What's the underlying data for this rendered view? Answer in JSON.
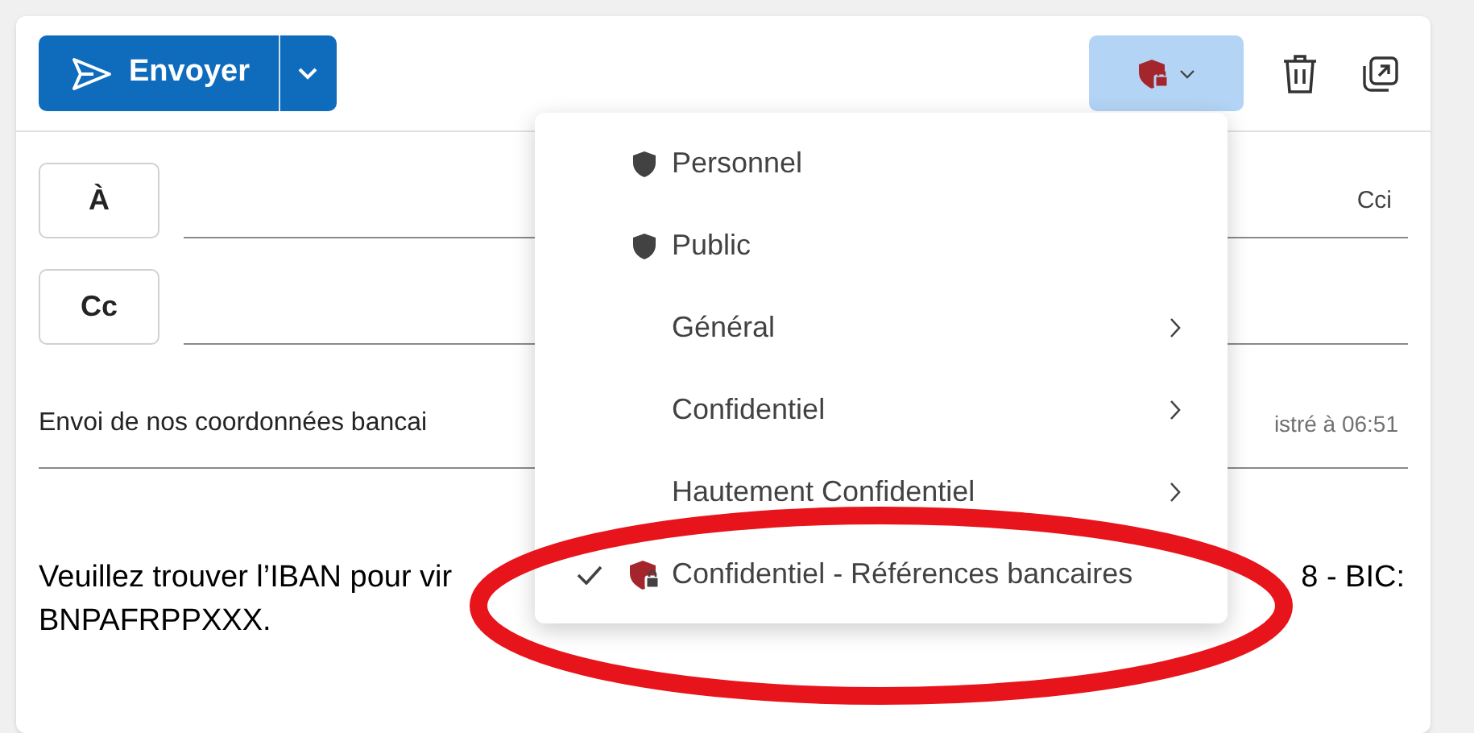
{
  "toolbar": {
    "send_label": "Envoyer",
    "sensitivity_open": true
  },
  "recipients": [
    {
      "label": "À",
      "trailing": "Cci"
    },
    {
      "label": "Cc"
    }
  ],
  "subject": {
    "value": "Envoi de nos coordonnées bancai",
    "saved_note": "istré à 06:51"
  },
  "body": {
    "line_1_start": "Veuillez trouver l’IBAN pour vir",
    "line_1_end": "8 - BIC:",
    "line_2": "BNPAFRPPXXX."
  },
  "menu": {
    "items": [
      {
        "label": "Personnel",
        "kind": "shield",
        "submenu": false,
        "selected": false
      },
      {
        "label": "Public",
        "kind": "shield",
        "submenu": false,
        "selected": false
      },
      {
        "label": "Général",
        "kind": "plain",
        "submenu": true,
        "selected": false
      },
      {
        "label": "Confidentiel",
        "kind": "plain",
        "submenu": true,
        "selected": false
      },
      {
        "label": "Hautement Confidentiel",
        "kind": "plain",
        "submenu": true,
        "selected": false
      },
      {
        "label": "Confidentiel - Références bancaires",
        "kind": "shield-lock",
        "submenu": false,
        "selected": true
      }
    ]
  }
}
